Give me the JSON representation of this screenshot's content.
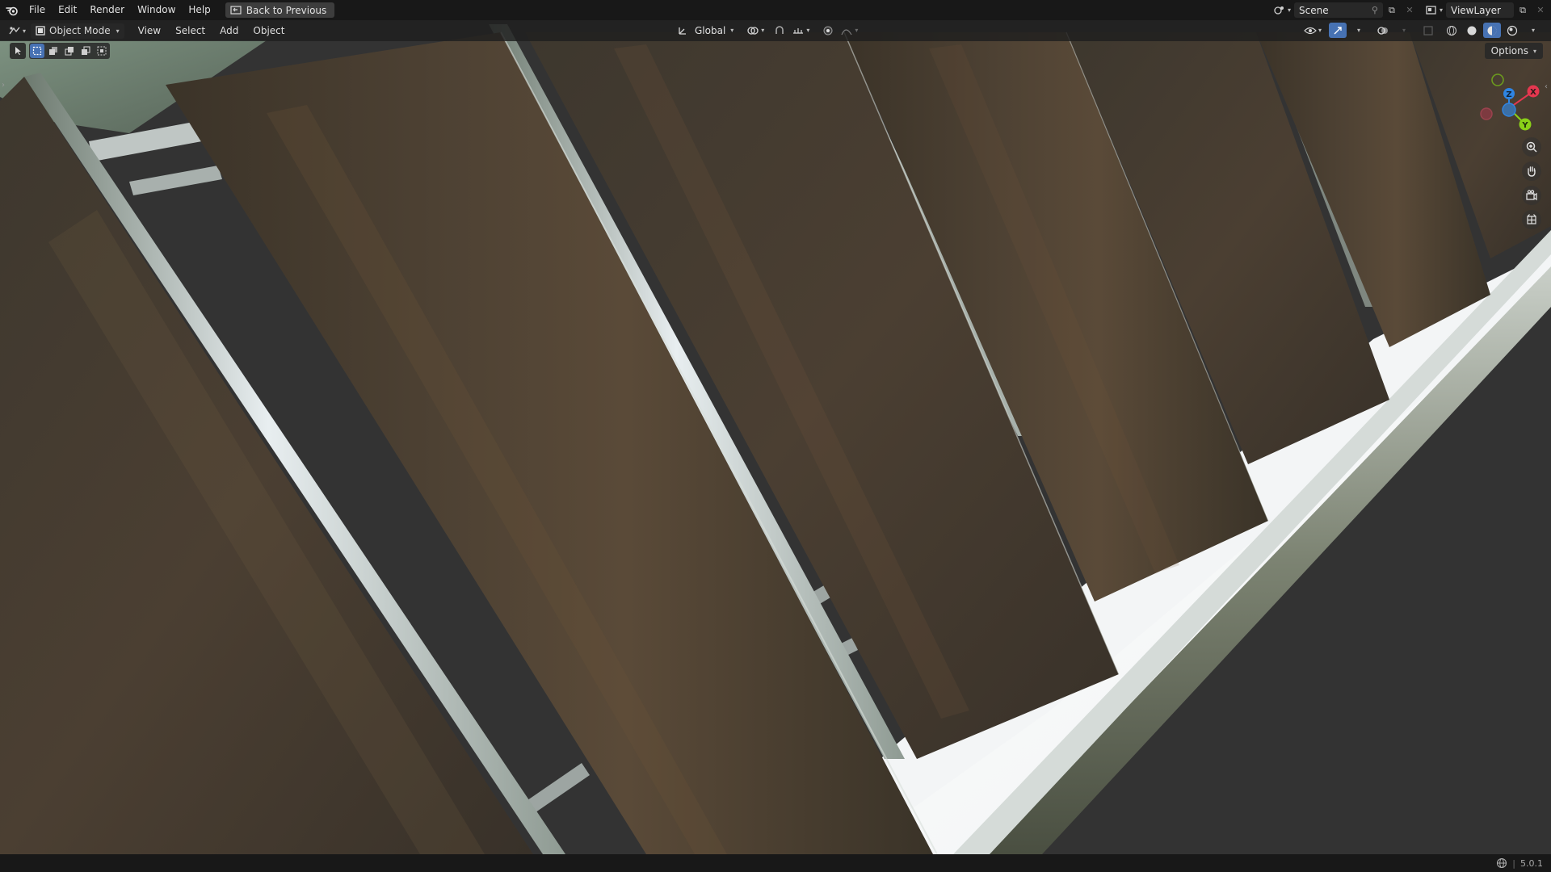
{
  "topbar": {
    "menus": [
      "File",
      "Edit",
      "Render",
      "Window",
      "Help"
    ],
    "back_label": "Back to Previous",
    "scene_label": "Scene",
    "viewlayer_label": "ViewLayer"
  },
  "viewport_header": {
    "mode_label": "Object Mode",
    "menus": [
      "View",
      "Select",
      "Add",
      "Object"
    ],
    "orientation_label": "Global",
    "options_label": "Options"
  },
  "gizmo": {
    "x_label": "X",
    "y_label": "Y",
    "z_label": "Z"
  },
  "status": {
    "version": "5.0.1"
  },
  "colors": {
    "topbar_bg": "#181818",
    "active_blue": "#4772b3",
    "axis_x": "#e5374f",
    "axis_y": "#8ad018",
    "axis_z": "#2f85e3"
  },
  "icons": {
    "blender_logo": "blender-logo-icon",
    "zoom": "zoom-icon",
    "pan": "hand-icon",
    "camera": "camera-icon",
    "grid": "grid-icon"
  }
}
